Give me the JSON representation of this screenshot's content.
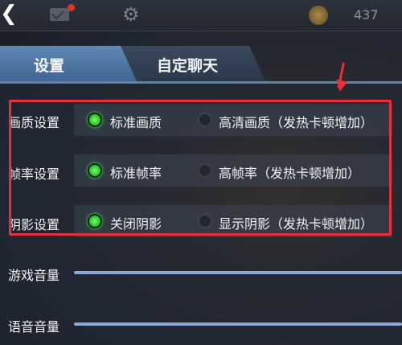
{
  "topbar": {
    "back_icon": "chevron-left-icon",
    "mail_icon": "mail-icon",
    "settings_icon": "gear-icon",
    "coin_icon": "coin-icon",
    "coin_value": "437",
    "notification_color": "#e0342a"
  },
  "tabs": [
    {
      "label": "设置",
      "active": true
    },
    {
      "label": "自定聊天",
      "active": false
    }
  ],
  "settings": {
    "quality": {
      "label": "画质设置",
      "options": [
        {
          "label": "标准画质",
          "selected": true
        },
        {
          "label": "高清画质（发热卡顿增加）",
          "selected": false
        }
      ]
    },
    "framerate": {
      "label": "帧率设置",
      "options": [
        {
          "label": "标准帧率",
          "selected": true
        },
        {
          "label": "高帧率（发热卡顿增加）",
          "selected": false
        }
      ]
    },
    "shadow": {
      "label": "阴影设置",
      "options": [
        {
          "label": "关闭阴影",
          "selected": true
        },
        {
          "label": "显示阴影（发热卡顿增加）",
          "selected": false
        }
      ]
    }
  },
  "volume": {
    "game": {
      "label": "游戏音量"
    },
    "voice": {
      "label": "语音音量"
    }
  },
  "colors": {
    "highlight": "#e8303a",
    "radio_on": "#2fd02b",
    "tab_active": "#4f77a3"
  }
}
